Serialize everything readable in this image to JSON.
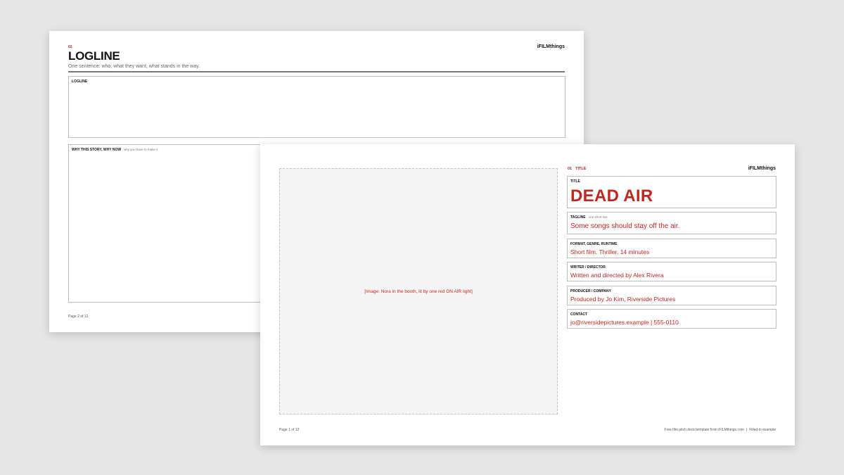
{
  "brand": "iFILMthings",
  "back_page": {
    "section_number": "02",
    "title": "LOGLINE",
    "subtitle": "One sentence: who, what they want, what stands in the way.",
    "logline_box": {
      "label": "LOGLINE"
    },
    "why_box": {
      "label": "WHY THIS STORY, WHY NOW",
      "hint": "why you have to make it"
    },
    "page_number": "Page 2 of 12"
  },
  "front_page": {
    "section_number": "01",
    "section_label": "TITLE",
    "image_placeholder": "[Image: Nora in the booth, lit by one red ON AIR light]",
    "fields": {
      "title": {
        "label": "TITLE",
        "value": "DEAD AIR"
      },
      "tagline": {
        "label": "TAGLINE",
        "hint": "one short line",
        "value": "Some songs should stay off the air."
      },
      "format": {
        "label": "FORMAT, GENRE, RUNTIME",
        "value": "Short film. Thriller. 14 minutes"
      },
      "writer": {
        "label": "WRITER / DIRECTOR",
        "value": "Written and directed by Alex Rivera"
      },
      "producer": {
        "label": "PRODUCER / COMPANY",
        "value": "Produced by Jo Kim, Riverside Pictures"
      },
      "contact": {
        "label": "CONTACT",
        "value": "jo@riversidepictures.example | 555-0110"
      }
    },
    "page_number": "Page 1 of 12",
    "footer_credit": "Free film pitch deck template from iFILMthings.com",
    "footer_separator": "|",
    "footer_note": "Filled-in example"
  }
}
